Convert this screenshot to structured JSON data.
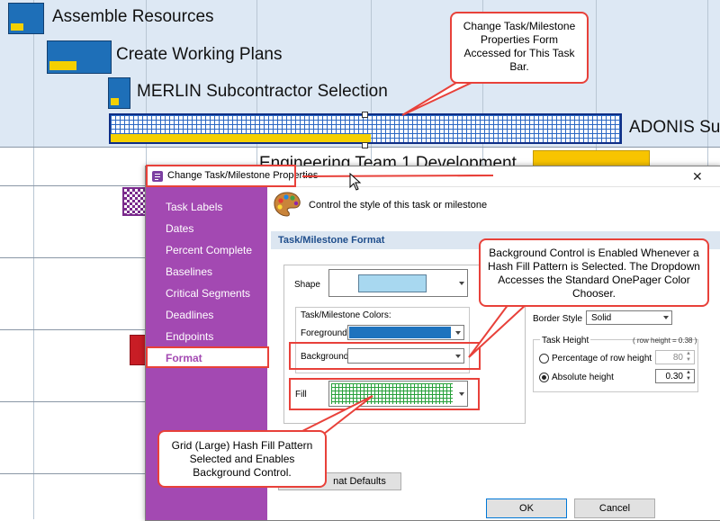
{
  "gantt": {
    "rows": [
      {
        "label": "Assemble Resources"
      },
      {
        "label": "Create Working Plans"
      },
      {
        "label": "MERLIN Subcontractor Selection"
      },
      {
        "label": "ADONIS Sub"
      },
      {
        "label": "Engineering Team 1 Development"
      }
    ]
  },
  "dialog": {
    "title": "Change Task/Milestone Properties",
    "header_text": "Control the style of this task or milestone",
    "nav_items": [
      "Task Labels",
      "Dates",
      "Percent Complete",
      "Baselines",
      "Critical Segments",
      "Deadlines",
      "Endpoints",
      "Format"
    ],
    "selected_nav": "Format",
    "section_title": "Task/Milestone Format",
    "shape_label": "Shape",
    "colors_group_label": "Task/Milestone Colors:",
    "foreground_label": "Foreground",
    "background_label": "Background",
    "fill_label": "Fill",
    "border_style_label": "Border Style",
    "border_style_value": "Solid",
    "task_height_label": "Task Height",
    "row_height_note": "( row height =  0.38  )",
    "pct_row_height_label": "Percentage of row height",
    "pct_row_height_value": "80",
    "absolute_height_label": "Absolute height",
    "absolute_height_value": "0.30",
    "format_defaults_button": "nat Defaults",
    "ok_button": "OK",
    "cancel_button": "Cancel",
    "close_glyph": "✕"
  },
  "callouts": {
    "top": "Change Task/Milestone Properties Form Accessed for This Task Bar.",
    "right": "Background Control is Enabled Whenever a Hash Fill Pattern is Selected. The Dropdown Accesses the Standard OnePager Color Chooser.",
    "bottom": "Grid (Large) Hash Fill Pattern Selected and Enables Background Control."
  },
  "colors": {
    "accent_red": "#e8413a",
    "sidebar_purple": "#a349b2",
    "task_blue": "#1e6fb8",
    "task_yellow": "#f5d000",
    "swatch_light_blue": "#a8d8f0"
  }
}
